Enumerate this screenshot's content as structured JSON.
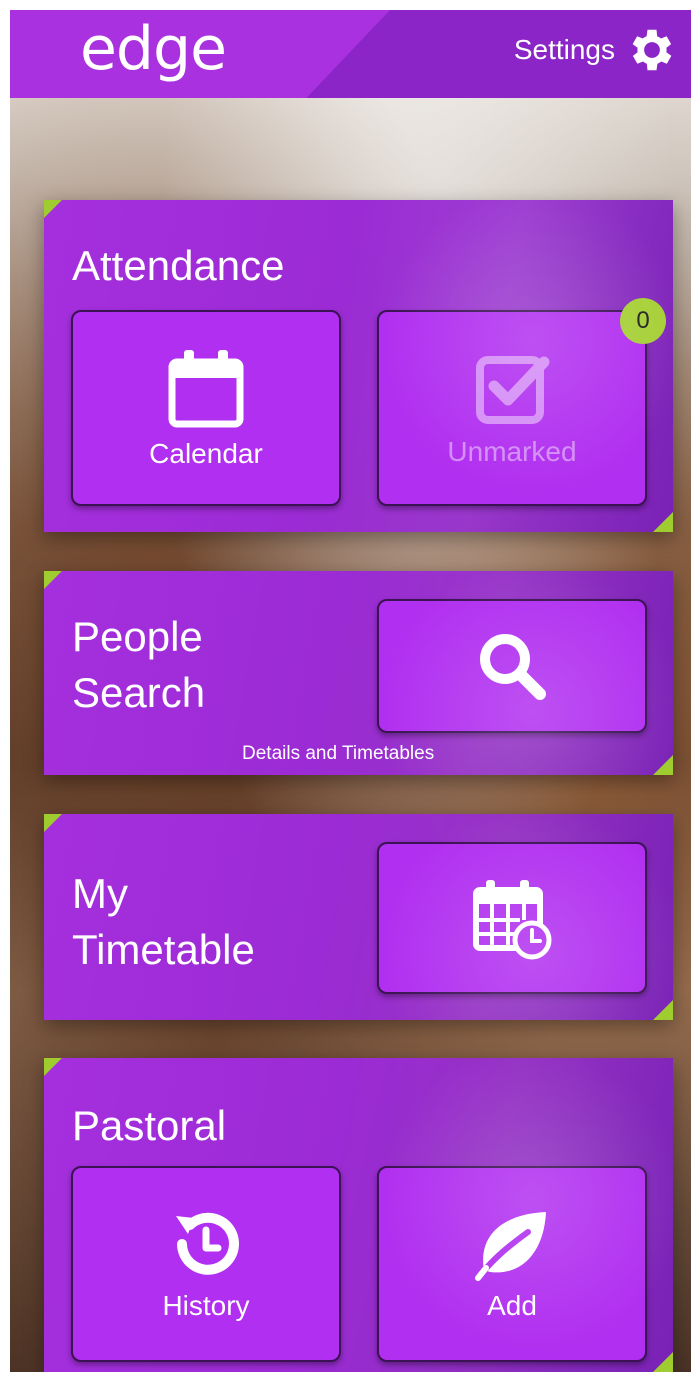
{
  "app": {
    "logo": "edge"
  },
  "header": {
    "settings_label": "Settings"
  },
  "attendance": {
    "title": "Attendance",
    "calendar_label": "Calendar",
    "unmarked_label": "Unmarked",
    "unmarked_count": "0"
  },
  "people_search": {
    "title_line1": "People",
    "title_line2": "Search",
    "caption": "Details and Timetables"
  },
  "timetable": {
    "title_line1": "My",
    "title_line2": "Timetable"
  },
  "pastoral": {
    "title": "Pastoral",
    "history_label": "History",
    "add_label": "Add"
  },
  "colors": {
    "brand_purple": "#a931e0",
    "tile_purple": "#b12ff0",
    "accent_green": "#9fcc2e"
  },
  "icons": [
    "gear-icon",
    "calendar-icon",
    "checkbox-icon",
    "search-icon",
    "timetable-icon",
    "history-icon",
    "leaf-icon"
  ]
}
